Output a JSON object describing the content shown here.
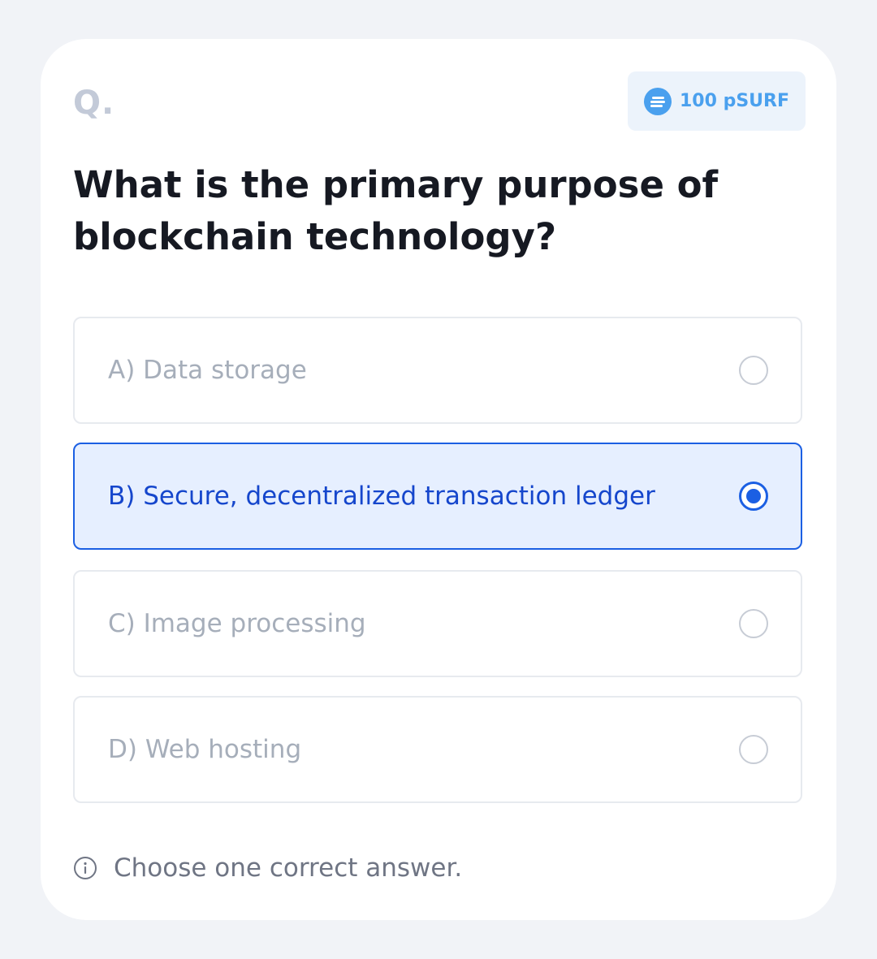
{
  "quiz": {
    "prefix": "Q.",
    "reward": {
      "icon": "coin-icon",
      "label": "100 pSURF",
      "color": "#4aa0ee"
    },
    "question": "What is the primary purpose of blockchain technology?",
    "options": [
      {
        "label": "A) Data storage",
        "selected": false
      },
      {
        "label": "B) Secure, decentralized transaction ledger",
        "selected": true
      },
      {
        "label": "C) Image processing",
        "selected": false
      },
      {
        "label": "D) Web hosting",
        "selected": false
      }
    ],
    "hint": {
      "icon": "info-icon",
      "text": "Choose one correct answer."
    },
    "colors": {
      "accent": "#1b5fe3",
      "selected_background": "#e6efff",
      "page_background": "#f1f3f7"
    }
  }
}
